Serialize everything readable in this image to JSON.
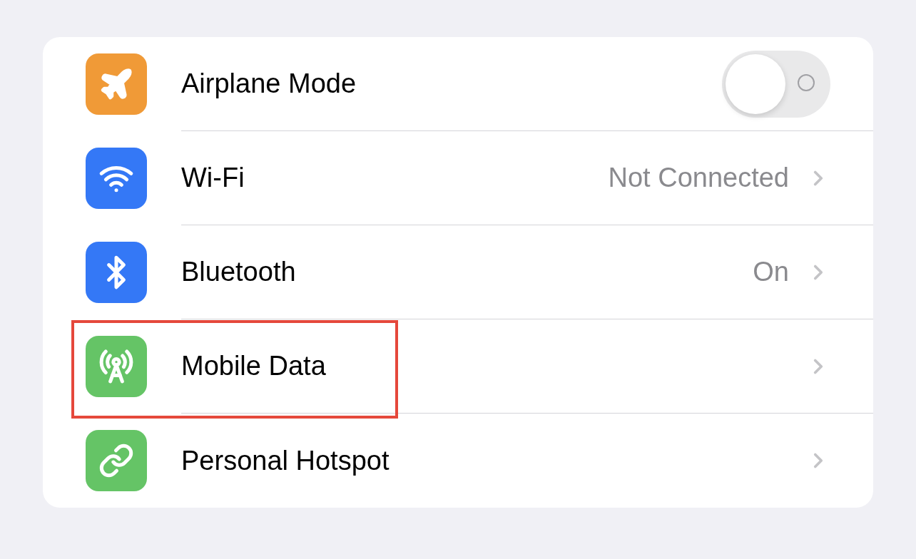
{
  "settings_group": {
    "rows": [
      {
        "kind": "toggle",
        "label": "Airplane Mode",
        "color": "#f09a37",
        "on": false,
        "highlighted": false
      },
      {
        "kind": "nav",
        "label": "Wi-Fi",
        "value": "Not Connected",
        "color": "#3478f6",
        "highlighted": false
      },
      {
        "kind": "nav",
        "label": "Bluetooth",
        "value": "On",
        "color": "#3478f6",
        "highlighted": false
      },
      {
        "kind": "nav",
        "label": "Mobile Data",
        "color": "#65c466",
        "highlighted": true
      },
      {
        "kind": "nav",
        "label": "Personal Hotspot",
        "color": "#65c466",
        "highlighted": false
      }
    ]
  }
}
